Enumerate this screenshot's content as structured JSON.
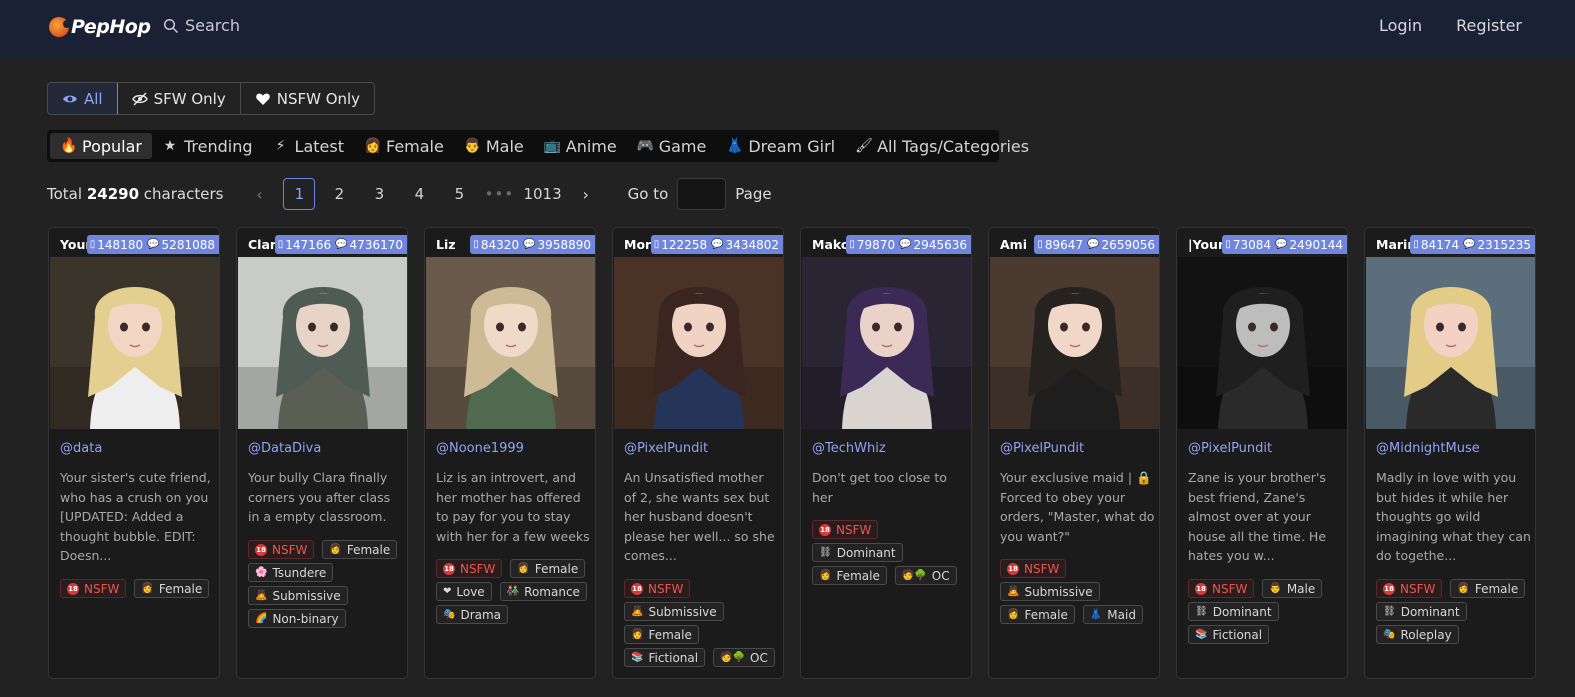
{
  "header": {
    "logo_text": "PepHop",
    "search_label": "Search",
    "login_label": "Login",
    "register_label": "Register"
  },
  "content_filter": {
    "options": [
      {
        "label": "All",
        "icon": "eye-icon",
        "active": true
      },
      {
        "label": "SFW Only",
        "icon": "eye-slash-icon",
        "active": false
      },
      {
        "label": "NSFW Only",
        "icon": "heart-icon",
        "active": false
      }
    ]
  },
  "category_tabs": [
    {
      "label": "Popular",
      "icon": "🔥",
      "active": true
    },
    {
      "label": "Trending",
      "icon": "★",
      "active": false
    },
    {
      "label": "Latest",
      "icon": "⚡",
      "active": false
    },
    {
      "label": "Female",
      "icon": "👩",
      "active": false
    },
    {
      "label": "Male",
      "icon": "👨",
      "active": false
    },
    {
      "label": "Anime",
      "icon": "📺",
      "active": false
    },
    {
      "label": "Game",
      "icon": "🎮",
      "active": false
    },
    {
      "label": "Dream Girl",
      "icon": "👗",
      "active": false
    },
    {
      "label": "All Tags/Categories",
      "icon": "🖌",
      "active": false
    }
  ],
  "pagination": {
    "total_prefix": "Total",
    "total_count": "24290",
    "total_suffix": "characters",
    "pages": [
      "1",
      "2",
      "3",
      "4",
      "5"
    ],
    "current_page": "1",
    "ellipsis": "•••",
    "last_page": "1013",
    "goto_label": "Go to",
    "page_label": "Page",
    "goto_value": ""
  },
  "cards": [
    {
      "name": "Your si",
      "messages": "148180",
      "chats": "5281088",
      "author": "@data",
      "description": "Your sister's cute friend, who has a crush on you [UPDATED: Added a thought bubble. EDIT: Doesn...",
      "tags": [
        {
          "label": "NSFW",
          "kind": "nsfw"
        },
        {
          "label": "Female",
          "icon": "👩"
        }
      ],
      "palette": {
        "bg": "#3b342b",
        "hair": "#e3cf8f",
        "skin": "#f2d6c4",
        "cloth": "#eeeeee"
      }
    },
    {
      "name": "Clara",
      "messages": "147166",
      "chats": "4736170",
      "author": "@DataDiva",
      "description": "Your bully Clara finally corners you after class in a empty classroom.",
      "tags": [
        {
          "label": "NSFW",
          "kind": "nsfw"
        },
        {
          "label": "Female",
          "icon": "👩"
        },
        {
          "label": "Tsundere",
          "icon": "🌸"
        },
        {
          "label": "Submissive",
          "icon": "🙇"
        },
        {
          "label": "Non-binary",
          "icon": "🌈"
        }
      ],
      "palette": {
        "bg": "#c9cbc7",
        "hair": "#4e5c55",
        "skin": "#e8d4c6",
        "cloth": "#5b5e52"
      }
    },
    {
      "name": "Liz",
      "messages": "84320",
      "chats": "3958890",
      "author": "@Noone1999",
      "description": "Liz is an introvert, and her mother has offered to pay for you to stay with her for a few weeks",
      "tags": [
        {
          "label": "NSFW",
          "kind": "nsfw"
        },
        {
          "label": "Female",
          "icon": "👩"
        },
        {
          "label": "Love",
          "icon": "❤"
        },
        {
          "label": "Romance",
          "icon": "👫"
        },
        {
          "label": "Drama",
          "icon": "🎭"
        }
      ],
      "palette": {
        "bg": "#6a5a4c",
        "hair": "#cdbb95",
        "skin": "#efd9c7",
        "cloth": "#4f6a4f"
      }
    },
    {
      "name": "Moriko",
      "messages": "122258",
      "chats": "3434802",
      "author": "@PixelPundit",
      "description": "An Unsatisfied mother of 2, she wants sex but her husband doesn't please her well... so she comes...",
      "tags": [
        {
          "label": "NSFW",
          "kind": "nsfw"
        },
        {
          "label": "Submissive",
          "icon": "🙇"
        },
        {
          "label": "Female",
          "icon": "👩"
        },
        {
          "label": "Fictional",
          "icon": "📚"
        },
        {
          "label": "OC",
          "icon": "🧑🌳"
        }
      ],
      "palette": {
        "bg": "#4a3226",
        "hair": "#3a2520",
        "skin": "#f0d3c2",
        "cloth": "#25355a"
      }
    },
    {
      "name": "Mako",
      "messages": "79870",
      "chats": "2945636",
      "author": "@TechWhiz",
      "description": "Don't get too close to her",
      "tags": [
        {
          "label": "NSFW",
          "kind": "nsfw"
        },
        {
          "label": "Dominant",
          "icon": "⛓"
        },
        {
          "label": "Female",
          "icon": "👩"
        },
        {
          "label": "OC",
          "icon": "🧑🌳"
        }
      ],
      "palette": {
        "bg": "#2a2533",
        "hair": "#3b2a55",
        "skin": "#ead2c8",
        "cloth": "#d9d4d0"
      }
    },
    {
      "name": "Ami",
      "messages": "89647",
      "chats": "2659056",
      "author": "@PixelPundit",
      "description": "Your exclusive maid | 🔒 Forced to obey your orders, \"Master, what do you want?\"",
      "tags": [
        {
          "label": "NSFW",
          "kind": "nsfw"
        },
        {
          "label": "Submissive",
          "icon": "🙇"
        },
        {
          "label": "Female",
          "icon": "👩"
        },
        {
          "label": "Maid",
          "icon": "👗"
        }
      ],
      "palette": {
        "bg": "#4a3a30",
        "hair": "#26221f",
        "skin": "#f0d7c7",
        "cloth": "#1e1e1e"
      }
    },
    {
      "name": "|Your Br",
      "messages": "73084",
      "chats": "2490144",
      "author": "@PixelPundit",
      "description": "Zane is your brother's best friend, Zane's almost over at your house all the time. He hates you w...",
      "tags": [
        {
          "label": "NSFW",
          "kind": "nsfw"
        },
        {
          "label": "Male",
          "icon": "👨"
        },
        {
          "label": "Dominant",
          "icon": "⛓"
        },
        {
          "label": "Fictional",
          "icon": "📚"
        }
      ],
      "palette": {
        "bg": "#121212",
        "hair": "#1f1f1f",
        "skin": "#bdbdbd",
        "cloth": "#2a2a2a"
      }
    },
    {
      "name": "Marin K",
      "messages": "84174",
      "chats": "2315235",
      "author": "@MidnightMuse",
      "description": "Madly in love with you but hides it while her thoughts go wild imagining what they can do togethe...",
      "tags": [
        {
          "label": "NSFW",
          "kind": "nsfw"
        },
        {
          "label": "Female",
          "icon": "👩"
        },
        {
          "label": "Dominant",
          "icon": "⛓"
        },
        {
          "label": "Roleplay",
          "icon": "🎭"
        }
      ],
      "palette": {
        "bg": "#5a6e7c",
        "hair": "#e2cc88",
        "skin": "#f3d2c4",
        "cloth": "#2a2a2a"
      }
    }
  ]
}
